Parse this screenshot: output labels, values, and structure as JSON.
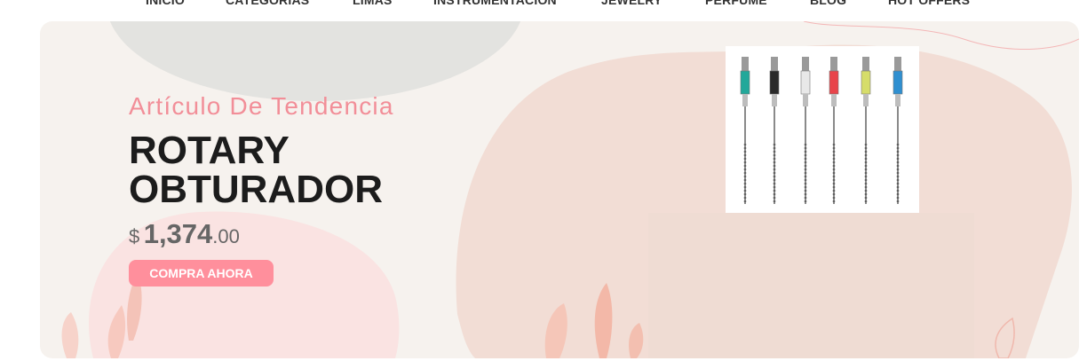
{
  "nav": {
    "items": [
      "INICIO",
      "CATEGORIAS",
      "LIMAS",
      "INSTRUMENTACIÓN",
      "JEWELRY",
      "PERFUME",
      "BLOG",
      "HOT OFFERS"
    ]
  },
  "hero": {
    "subtitle": "Artículo De Tendencia",
    "title": "ROTARY OBTURADOR",
    "price": {
      "currency": "$",
      "whole": "1,374",
      "cents": ".00"
    },
    "button_label": "COMPRA AHORA",
    "product_image": "rotary-files-image"
  },
  "colors": {
    "accent": "#ff8f9c",
    "subtitle": "#f28e98",
    "title": "#1c1c1c",
    "banner_bg": "#f6f2ee",
    "blob_peach": "#f2ddd5",
    "blob_grey": "#e3e3e0",
    "blob_pink": "#fae3e2"
  },
  "file_colors": [
    "#22a89a",
    "#2a2a2a",
    "#e8e8e8",
    "#e8444a",
    "#d6dd6a",
    "#2f8fd0"
  ]
}
